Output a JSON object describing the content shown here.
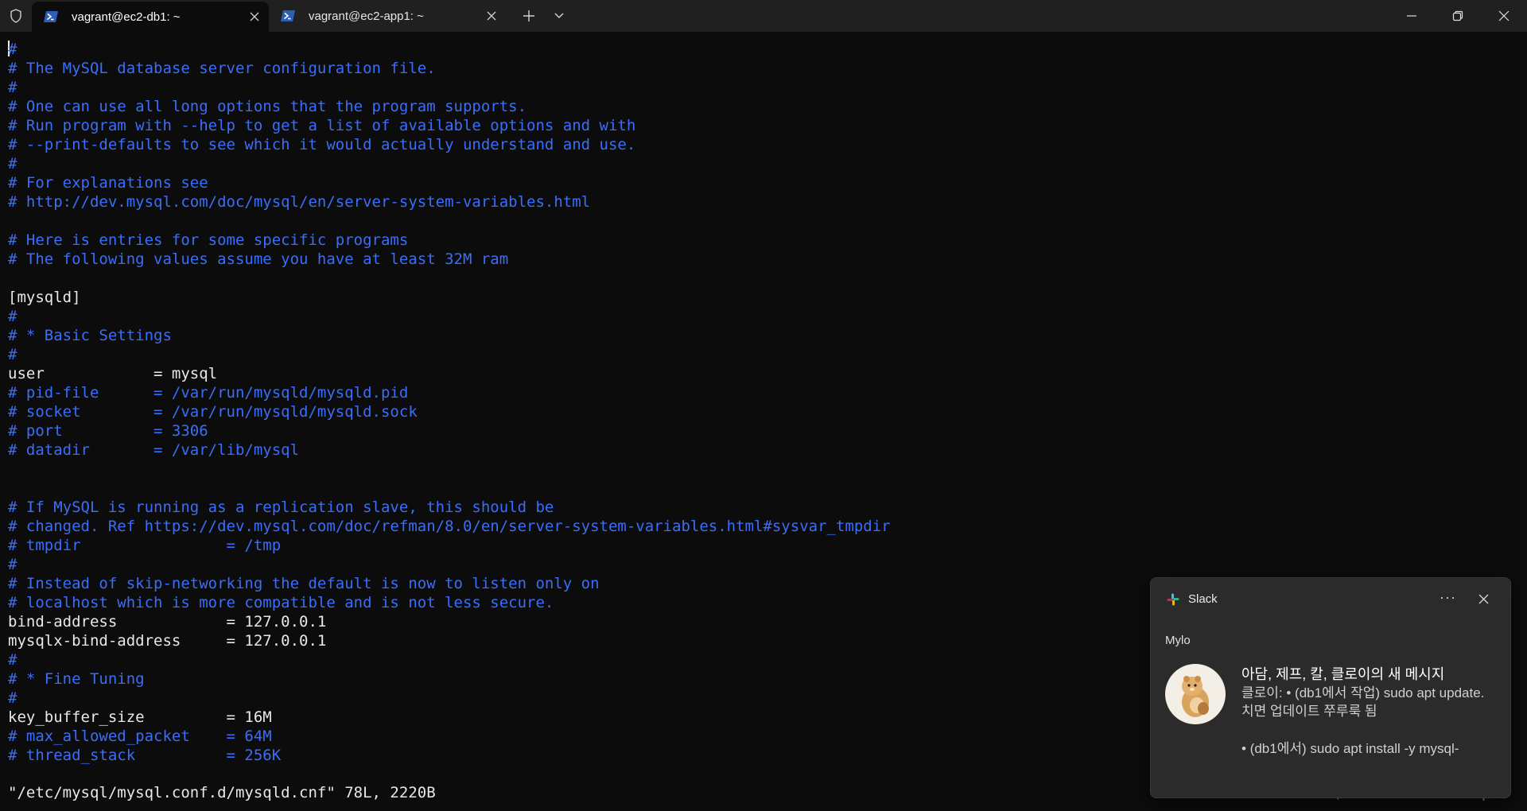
{
  "tabs": [
    {
      "title": "vagrant@ec2-db1: ~",
      "active": true
    },
    {
      "title": "vagrant@ec2-app1: ~",
      "active": false
    }
  ],
  "icons": {
    "shield": "shield-icon",
    "powershell": "powershell-icon",
    "close": "close-icon",
    "new_tab": "plus-icon",
    "dropdown": "chevron-down-icon"
  },
  "terminal": {
    "lines": [
      {
        "text": "#",
        "kind": "comment"
      },
      {
        "text": "# The MySQL database server configuration file.",
        "kind": "comment"
      },
      {
        "text": "#",
        "kind": "comment"
      },
      {
        "text": "# One can use all long options that the program supports.",
        "kind": "comment"
      },
      {
        "text": "# Run program with --help to get a list of available options and with",
        "kind": "comment"
      },
      {
        "text": "# --print-defaults to see which it would actually understand and use.",
        "kind": "comment"
      },
      {
        "text": "#",
        "kind": "comment"
      },
      {
        "text": "# For explanations see",
        "kind": "comment"
      },
      {
        "text": "# http://dev.mysql.com/doc/mysql/en/server-system-variables.html",
        "kind": "comment"
      },
      {
        "text": "",
        "kind": "plain"
      },
      {
        "text": "# Here is entries for some specific programs",
        "kind": "comment"
      },
      {
        "text": "# The following values assume you have at least 32M ram",
        "kind": "comment"
      },
      {
        "text": "",
        "kind": "plain"
      },
      {
        "text": "[mysqld]",
        "kind": "plain"
      },
      {
        "text": "#",
        "kind": "comment"
      },
      {
        "text": "# * Basic Settings",
        "kind": "comment"
      },
      {
        "text": "#",
        "kind": "comment"
      },
      {
        "text": "user            = mysql",
        "kind": "plain"
      },
      {
        "text": "# pid-file      = /var/run/mysqld/mysqld.pid",
        "kind": "comment"
      },
      {
        "text": "# socket        = /var/run/mysqld/mysqld.sock",
        "kind": "comment"
      },
      {
        "text": "# port          = 3306",
        "kind": "comment"
      },
      {
        "text": "# datadir       = /var/lib/mysql",
        "kind": "comment"
      },
      {
        "text": "",
        "kind": "plain"
      },
      {
        "text": "",
        "kind": "plain"
      },
      {
        "text": "# If MySQL is running as a replication slave, this should be",
        "kind": "comment"
      },
      {
        "text": "# changed. Ref https://dev.mysql.com/doc/refman/8.0/en/server-system-variables.html#sysvar_tmpdir",
        "kind": "comment"
      },
      {
        "text": "# tmpdir                = /tmp",
        "kind": "comment"
      },
      {
        "text": "#",
        "kind": "comment"
      },
      {
        "text": "# Instead of skip-networking the default is now to listen only on",
        "kind": "comment"
      },
      {
        "text": "# localhost which is more compatible and is not less secure.",
        "kind": "comment"
      },
      {
        "text": "bind-address            = 127.0.0.1",
        "kind": "plain"
      },
      {
        "text": "mysqlx-bind-address     = 127.0.0.1",
        "kind": "plain"
      },
      {
        "text": "#",
        "kind": "comment"
      },
      {
        "text": "# * Fine Tuning",
        "kind": "comment"
      },
      {
        "text": "#",
        "kind": "comment"
      },
      {
        "text": "key_buffer_size         = 16M",
        "kind": "plain"
      },
      {
        "text": "# max_allowed_packet    = 64M",
        "kind": "comment"
      },
      {
        "text": "# thread_stack          = 256K",
        "kind": "comment"
      }
    ],
    "status_line": "\"/etc/mysql/mysql.conf.d/mysqld.cnf\" 78L, 2220B",
    "position": "1,1",
    "scroll": "Top"
  },
  "notification": {
    "app": "Slack",
    "more_label": "···",
    "sender": "Mylo",
    "title": "아담, 제프, 칼, 클로이의 새 메시지",
    "body_lines": [
      "클로이: • (db1에서 작업) sudo apt update.",
      "치면 업데이트 쭈루룩 됨",
      "",
      "• (db1에서) sudo apt install -y mysql-"
    ],
    "avatar": "hamster-avatar"
  }
}
